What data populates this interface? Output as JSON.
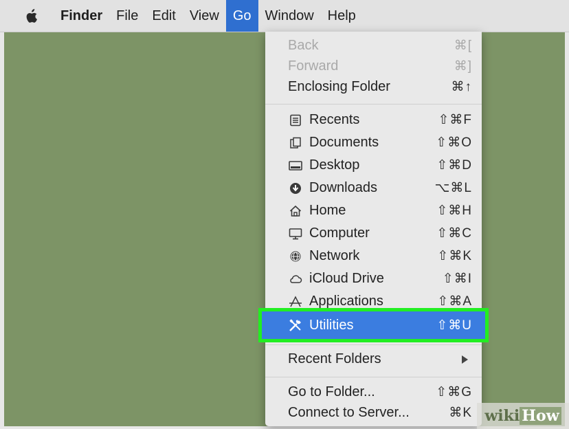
{
  "menubar": {
    "apple_icon": "apple-logo-icon",
    "items": [
      {
        "label": "Finder"
      },
      {
        "label": "File"
      },
      {
        "label": "Edit"
      },
      {
        "label": "View"
      },
      {
        "label": "Go"
      },
      {
        "label": "Window"
      },
      {
        "label": "Help"
      }
    ]
  },
  "go_menu": {
    "back": {
      "label": "Back",
      "shortcut": "⌘["
    },
    "forward": {
      "label": "Forward",
      "shortcut": "⌘]"
    },
    "enclosing": {
      "label": "Enclosing Folder",
      "shortcut": "⌘↑"
    },
    "recents": {
      "label": "Recents",
      "shortcut": "⇧⌘F",
      "icon": "recents-icon"
    },
    "documents": {
      "label": "Documents",
      "shortcut": "⇧⌘O",
      "icon": "documents-icon"
    },
    "desktop": {
      "label": "Desktop",
      "shortcut": "⇧⌘D",
      "icon": "desktop-icon"
    },
    "downloads": {
      "label": "Downloads",
      "shortcut": "⌥⌘L",
      "icon": "downloads-icon"
    },
    "home": {
      "label": "Home",
      "shortcut": "⇧⌘H",
      "icon": "home-icon"
    },
    "computer": {
      "label": "Computer",
      "shortcut": "⇧⌘C",
      "icon": "computer-icon"
    },
    "network": {
      "label": "Network",
      "shortcut": "⇧⌘K",
      "icon": "network-icon"
    },
    "icloud": {
      "label": "iCloud Drive",
      "shortcut": "⇧⌘I",
      "icon": "cloud-icon"
    },
    "applications": {
      "label": "Applications",
      "shortcut": "⇧⌘A",
      "icon": "applications-icon"
    },
    "utilities": {
      "label": "Utilities",
      "shortcut": "⇧⌘U",
      "icon": "utilities-icon"
    },
    "recent_folders": {
      "label": "Recent Folders"
    },
    "go_to_folder": {
      "label": "Go to Folder...",
      "shortcut": "⇧⌘G"
    },
    "connect_server": {
      "label": "Connect to Server...",
      "shortcut": "⌘K"
    }
  },
  "colors": {
    "desktop": "#7d9466",
    "selection": "#3b7de0",
    "highlight_outline": "#22ee22"
  },
  "watermark": {
    "part1": "wiki",
    "part2": "How"
  }
}
